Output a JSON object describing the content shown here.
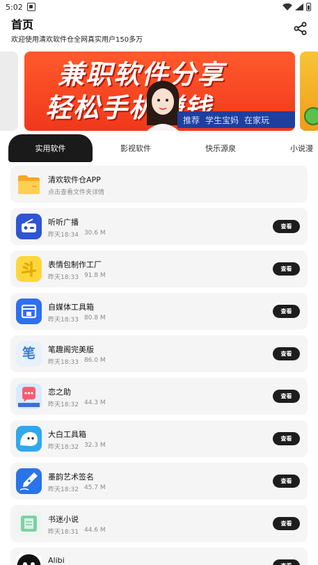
{
  "status_bar": {
    "time": "5:02"
  },
  "header": {
    "title": "首页",
    "subtitle": "欢迎使用清欢软件仓全网真实用户150多万"
  },
  "banner": {
    "line1": "兼职软件分享",
    "line2": "轻松手机赚钱",
    "tag_items": [
      "推荐",
      "学生宝妈",
      "在家玩"
    ]
  },
  "tabs": [
    "实用软件",
    "影视软件",
    "快乐源泉",
    "小说漫"
  ],
  "featured": {
    "title": "清欢软件仓APP",
    "subtitle": "点击查看文件夹详情"
  },
  "view_label": "查看",
  "apps": [
    {
      "name": "听听广播",
      "date": "昨天18:34",
      "size": "30.6 M",
      "icon": "radio-icon"
    },
    {
      "name": "表情包制作工厂",
      "date": "昨天18:33",
      "size": "91.8 M",
      "icon": "emoji-factory-icon"
    },
    {
      "name": "自媒体工具箱",
      "date": "昨天18:33",
      "size": "80.8 M",
      "icon": "media-toolbox-icon"
    },
    {
      "name": "笔趣阁完美版",
      "date": "昨天18:33",
      "size": "86.0 M",
      "icon": "novel-reader-icon"
    },
    {
      "name": "恋之助",
      "date": "昨天18:32",
      "size": "44.3 M",
      "icon": "love-chat-icon"
    },
    {
      "name": "大白工具箱",
      "date": "昨天18:32",
      "size": "32.3 M",
      "icon": "dabai-icon"
    },
    {
      "name": "墨韵艺术签名",
      "date": "昨天18:32",
      "size": "45.7 M",
      "icon": "pen-signature-icon"
    },
    {
      "name": "书迷小说",
      "date": "昨天18:31",
      "size": "44.6 M",
      "icon": "book-icon"
    },
    {
      "name": "Alibi",
      "date": "",
      "size": "",
      "icon": "alibi-icon"
    }
  ],
  "colors": {
    "card_bg": "#f5f5f6",
    "button_bg": "#1d1d1d",
    "banner_red": "#f0381b",
    "active_tab": "#1a1a1a"
  }
}
